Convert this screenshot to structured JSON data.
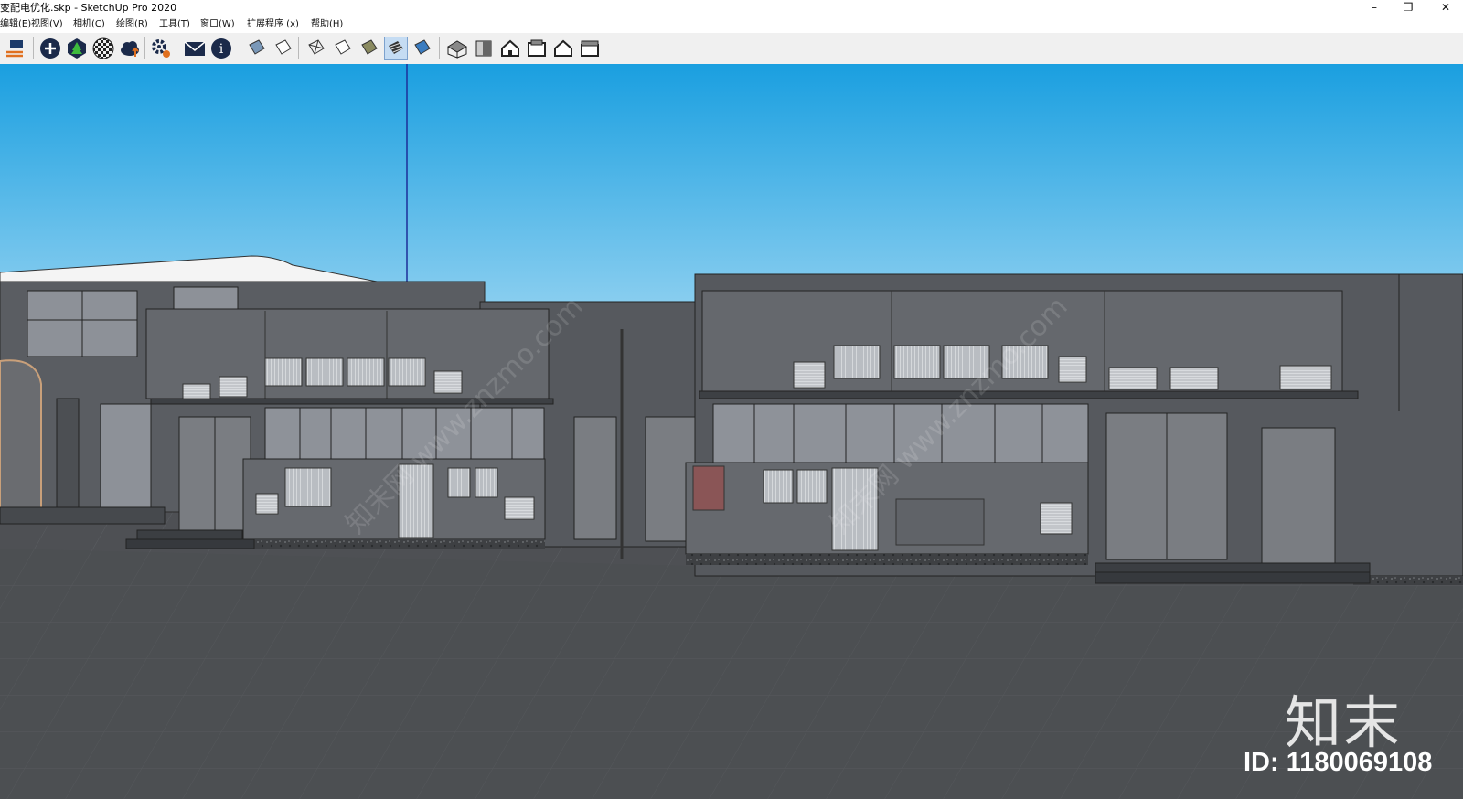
{
  "window": {
    "title": "变配电优化.skp - SketchUp Pro 2020",
    "controls": [
      "–",
      "❐",
      "✕"
    ]
  },
  "menu": [
    {
      "label": "编辑(E)"
    },
    {
      "label": "视图(V)"
    },
    {
      "label": "相机(C)"
    },
    {
      "label": "绘图(R)"
    },
    {
      "label": "工具(T)"
    },
    {
      "label": "窗口(W)"
    },
    {
      "label": "扩展程序 (x)"
    },
    {
      "label": "帮助(H)"
    }
  ],
  "toolbar": {
    "icons": [
      "model-info-icon",
      "add-location-icon",
      "tree-component-icon",
      "checker-material-icon",
      "cloud-upload-icon",
      "extension-gear-icon",
      "send-mail-icon",
      "info-icon",
      "shaded-style-icon",
      "outline-style-icon",
      "xray-icon",
      "hidden-line-icon",
      "shaded-icon",
      "shaded-textures-icon",
      "monochrome-icon",
      "iso-view-icon",
      "top-view-icon",
      "front-view-icon",
      "right-view-icon",
      "back-view-icon",
      "left-view-icon"
    ],
    "active_icon": "shaded-textures-icon"
  },
  "colors": {
    "sky_top": "#1a9fe0",
    "sky_bottom": "#8ccff0",
    "ground": "#4e5054",
    "building": "#56595e",
    "glass": "#8e9299"
  },
  "watermark": {
    "site_text": "知末网 www.znzmo.com",
    "logo_text": "知末",
    "id_text": "ID: 1180069108"
  }
}
